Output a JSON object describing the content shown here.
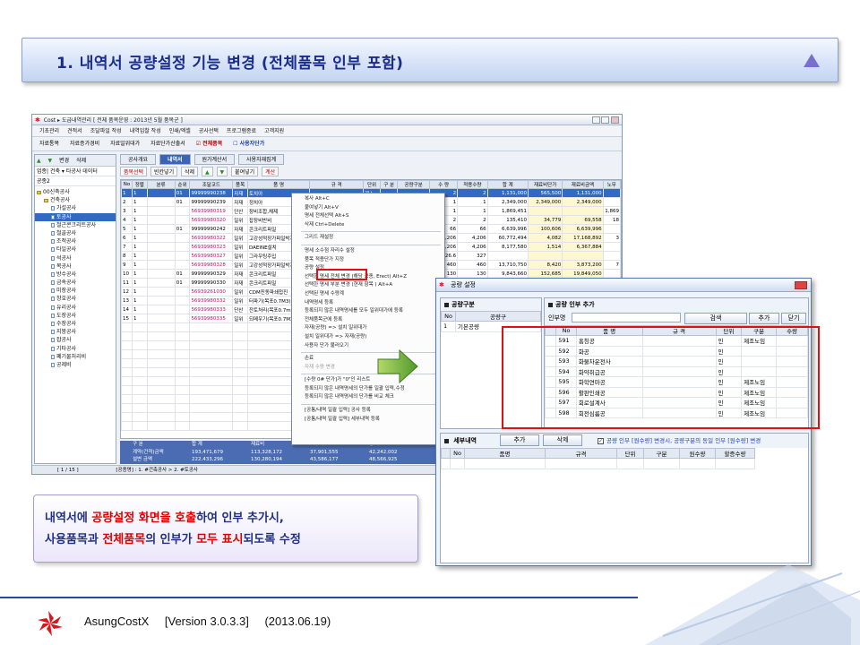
{
  "slide": {
    "title": "1. 내역서 공량설정 기능 변경 (전체품목 인부 포함)",
    "note_line1": {
      "a": "내역서에 ",
      "b": "공량설정 화면을 호출",
      "c": "하여 인부 추가시,"
    },
    "note_line2": {
      "a": "사용품목",
      "b": "과 ",
      "c": "전체품목",
      "d": "의 인부가 ",
      "e": "모두 표시",
      "f": "되도록 수정"
    },
    "footer": {
      "product": "AsungCostX",
      "version": "[Version 3.0.3.3]",
      "date": "(2013.06.19)"
    }
  },
  "main_window": {
    "title": "Cost ▸ 도급내역관리 [ 전체 품목운영 : 2013년 5월 품목군 ]",
    "menu": [
      "기초관리",
      "견적서",
      "조달파일 작성",
      "내역입찰 작성",
      "인쇄/엑셀",
      "공사선택",
      "프로그램종료",
      "고객지원"
    ],
    "toolbar": [
      "자료통목",
      "자료증가경비",
      "자료일위대가",
      "자료단가산출서"
    ],
    "toolbar_check1": "☑ 전체품목",
    "toolbar_check2": "☐ 사용자단가",
    "left_buttons": [
      "변경",
      "삭제"
    ],
    "left_row1": "업종| 건축 ▾ 타공사 데이터",
    "left_row2": "공종2",
    "tree": [
      {
        "label": "00신축공사",
        "type": "fold",
        "indent": 0
      },
      {
        "label": "건축공사",
        "type": "fold",
        "indent": 1
      },
      {
        "label": "가설공사",
        "type": "doc",
        "indent": 2
      },
      {
        "label": "토공사",
        "type": "doc",
        "indent": 2,
        "selected": true
      },
      {
        "label": "철근콘크리트공사",
        "type": "doc",
        "indent": 2
      },
      {
        "label": "철골공사",
        "type": "doc",
        "indent": 2
      },
      {
        "label": "조적공사",
        "type": "doc",
        "indent": 2
      },
      {
        "label": "타일공사",
        "type": "doc",
        "indent": 2
      },
      {
        "label": "석공사",
        "type": "doc",
        "indent": 2
      },
      {
        "label": "목공사",
        "type": "doc",
        "indent": 2
      },
      {
        "label": "방수공사",
        "type": "doc",
        "indent": 2
      },
      {
        "label": "금속공사",
        "type": "doc",
        "indent": 2
      },
      {
        "label": "미장공사",
        "type": "doc",
        "indent": 2
      },
      {
        "label": "창호공사",
        "type": "doc",
        "indent": 2
      },
      {
        "label": "유리공사",
        "type": "doc",
        "indent": 2
      },
      {
        "label": "도장공사",
        "type": "doc",
        "indent": 2
      },
      {
        "label": "수장공사",
        "type": "doc",
        "indent": 2
      },
      {
        "label": "지붕공사",
        "type": "doc",
        "indent": 2
      },
      {
        "label": "잡공사",
        "type": "doc",
        "indent": 2
      },
      {
        "label": "기타공사",
        "type": "doc",
        "indent": 2
      },
      {
        "label": "폐기물처리비",
        "type": "doc",
        "indent": 2
      },
      {
        "label": "공제비",
        "type": "doc",
        "indent": 2
      }
    ],
    "tabs": [
      {
        "label": "공사개요",
        "active": false
      },
      {
        "label": "내역서",
        "active": true
      },
      {
        "label": "원가계산서",
        "active": false
      },
      {
        "label": "사용자재집계",
        "active": false
      }
    ],
    "subbuttons": [
      "품목선택",
      "빈칸넣기",
      "삭제",
      "붙여넣기",
      "계산"
    ],
    "grid_headers": [
      "No",
      "정렬",
      "분류",
      "순위",
      "조달코드",
      "품목",
      "품 명",
      "규 격",
      "단위",
      "구 분",
      "공량구분",
      "수 량",
      "적용수량",
      "합 계",
      "재료비단가",
      "재료비금액",
      "노무"
    ],
    "grid_rows": [
      [
        "1",
        "1",
        "",
        "01",
        "99999990238",
        "자재",
        "토치아",
        "",
        "개소",
        "",
        "",
        "2",
        "2",
        "1,131,000",
        "565,500",
        "1,131,000",
        ""
      ],
      [
        "2",
        "1",
        "",
        "01",
        "99999990239",
        "자재",
        "정치아",
        "",
        "",
        "",
        "",
        "1",
        "1",
        "2,349,000",
        "2,349,000",
        "2,349,000",
        ""
      ],
      [
        "3",
        "1",
        "",
        "",
        "56939980319",
        "단산",
        "장비조합,체제",
        "",
        "",
        "",
        "",
        "1",
        "1",
        "1,869,451",
        "",
        "",
        "1,869"
      ],
      [
        "4",
        "1",
        "",
        "",
        "56939980320",
        "일위",
        "잡장비반비",
        "",
        "",
        "",
        "",
        "2",
        "2",
        "135,410",
        "34,779",
        "69,558",
        "18"
      ],
      [
        "5",
        "1",
        "",
        "01",
        "99999990242",
        "자재",
        "콘크리트파일",
        "",
        "",
        "",
        "",
        "66",
        "66",
        "6,639,996",
        "100,606",
        "6,639,996",
        ""
      ],
      [
        "6",
        "1",
        "",
        "",
        "56939980322",
        "일위",
        "고강성적장가파일박기",
        "",
        "",
        "",
        "",
        "4,206",
        "4,206",
        "60,772,494",
        "4,082",
        "17,168,892",
        "3"
      ],
      [
        "7",
        "1",
        "",
        "",
        "56939980323",
        "일위",
        "DAEINE설치",
        "",
        "",
        "",
        "",
        "4,206",
        "4,206",
        "8,177,580",
        "1,514",
        "6,367,884",
        ""
      ],
      [
        "8",
        "1",
        "",
        "",
        "56939980327",
        "일위",
        "그라우팅주입",
        "",
        "",
        "",
        "",
        "326.6",
        "327",
        "",
        "",
        "",
        ""
      ],
      [
        "9",
        "1",
        "",
        "",
        "56939980328",
        "일위",
        "고강성적장가파일박기",
        "",
        "",
        "",
        "",
        "460",
        "460",
        "13,710,750",
        "8,420",
        "3,873,200",
        "7"
      ],
      [
        "10",
        "1",
        "",
        "01",
        "99999990329",
        "자재",
        "콘크리트파일",
        "",
        "",
        "",
        "",
        "130",
        "130",
        "9,843,660",
        "152,685",
        "19,849,050",
        ""
      ],
      [
        "11",
        "1",
        "",
        "01",
        "99999990330",
        "자재",
        "콘크리트파일",
        "",
        "",
        "",
        "",
        "",
        "",
        "",
        "",
        "",
        ""
      ],
      [
        "12",
        "1",
        "",
        "",
        "56939261030",
        "일위",
        "CDM진동파쇄접진",
        "",
        "",
        "",
        "",
        "",
        "",
        "",
        "",
        "",
        ""
      ],
      [
        "13",
        "1",
        "",
        "",
        "56939980332",
        "일위",
        "터파기(목포0.7M3)",
        "",
        "",
        "",
        "",
        "",
        "",
        "",
        "",
        "",
        ""
      ],
      [
        "14",
        "1",
        "",
        "",
        "56939980333",
        "단산",
        "잔토처리(목포0.7m³)",
        "",
        "",
        "",
        "",
        "",
        "",
        "",
        "",
        "",
        ""
      ],
      [
        "15",
        "1",
        "",
        "",
        "56939980335",
        "일위",
        "되메우기(목포0.7M3)",
        "",
        "",
        "",
        "",
        "",
        "",
        "",
        "",
        "",
        ""
      ]
    ],
    "context_menu": [
      "복사 Alt+C",
      "붙여넣기 Alt+V",
      "명세 전체선택 Alt+S",
      "삭제 Ctrl+Delete",
      "-",
      "그리드 재설정",
      "-",
      "명세 소수점 자리수 설정",
      "품목 적용단가 지정",
      "공량 설정",
      "선택한 명세 전체 변경 (해당 공종, Erect) Alt+Z",
      "선택한 명세 부분 변경 (현재 항목 ) Alt+A",
      "선택된 명세 수량계",
      "내역명세 등록",
      "등록되지 않은 내역명세를 모두 일위대가에 등록",
      "전체품목군에 등록",
      "자재(공량) => 설치 일위대가",
      "설치 일위대가 => 자재(공량)",
      "사용자 단가 불러오기",
      "-",
      "손료",
      "자재 수량 변경",
      "-",
      "[수량 0# 단가]가 \"0\"인 리스트",
      "등록되지 않은 내역명세의 단가를 일괄 입력,수정",
      "등록되지 않은 내역명세의 단가를 비교 체크",
      "-",
      "[공통/내역 일괄 입력] 공사 등록",
      "[공통/내역 일괄 입력] 세부내역 등록"
    ],
    "summary": {
      "hdr": [
        "구  분",
        "합  계",
        "재료비",
        "노무비",
        "경  비"
      ],
      "row1": [
        "계약(건적)금액",
        "193,471,679",
        "113,328,172",
        "37,901,555",
        "42,242,002"
      ],
      "row2": [
        "설변     금액",
        "222,433,296",
        "130,280,194",
        "43,586,177",
        "48,566,925"
      ]
    },
    "status": [
      "[ 1 / 15 ]",
      "[공종명] : 1. #건축공사 > 2. #토공사"
    ]
  },
  "dialog": {
    "title": "공량 설정",
    "left_header": "공량구분",
    "left_cols": [
      "No",
      "공량구"
    ],
    "left_rows": [
      [
        "1",
        "기본공량"
      ]
    ],
    "right_header": "공량 인부 추가",
    "search_label": "인부명",
    "search_placeholder": "",
    "search_btn": "검색",
    "add_btn": "추가",
    "close_btn": "닫기",
    "right_cols": [
      "No",
      "품   명",
      "규   격",
      "단위",
      "구분",
      "수량"
    ],
    "right_rows": [
      [
        "591",
        "홈칭공",
        "",
        "인",
        "제조노임",
        ""
      ],
      [
        "592",
        "화공",
        "",
        "인",
        "",
        ""
      ],
      [
        "593",
        "화물차운전사",
        "",
        "인",
        "",
        ""
      ],
      [
        "594",
        "화약취급공",
        "",
        "인",
        "",
        ""
      ],
      [
        "595",
        "화학연마공",
        "",
        "인",
        "제조노임",
        ""
      ],
      [
        "596",
        "활판인쇄공",
        "",
        "인",
        "제조노임",
        ""
      ],
      [
        "597",
        "회로설계사",
        "",
        "인",
        "제조노임",
        ""
      ],
      [
        "598",
        "회전심름공",
        "",
        "인",
        "제조노임",
        ""
      ]
    ],
    "detail_header": "세부내역",
    "detail_add": "추가",
    "detail_delete": "삭제",
    "detail_note": "공량 인부 [원수량] 변경시, 공량구분의 동일 인부 [원수량] 변경",
    "detail_cols": [
      "No",
      "품명",
      "규격",
      "단위",
      "구분",
      "원수량",
      "할증수량"
    ]
  }
}
